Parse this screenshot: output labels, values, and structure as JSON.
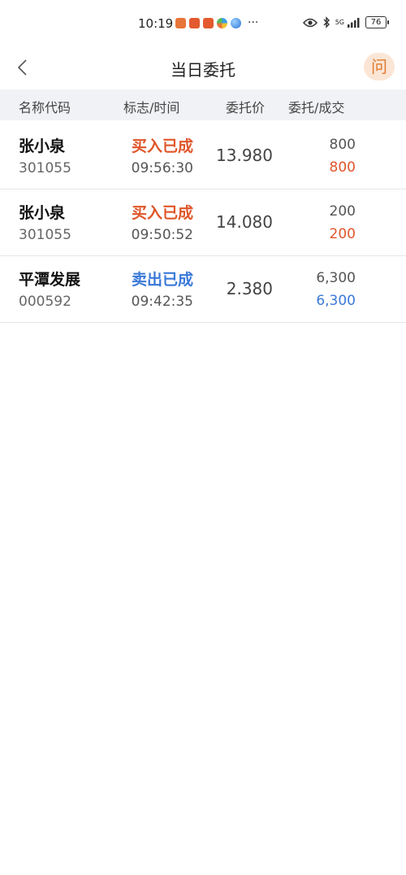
{
  "status_bar": {
    "time": "10:19",
    "network": "5G",
    "battery": "76",
    "more": "···"
  },
  "header": {
    "title": "当日委托",
    "ask_label": "问"
  },
  "columns": {
    "name": "名称代码",
    "flag_time": "标志/时间",
    "price": "委托价",
    "qty_filled": "委托/成交"
  },
  "orders": [
    {
      "name": "张小泉",
      "code": "301055",
      "flag": "买入已成",
      "side": "buy",
      "time": "09:56:30",
      "price": "13.980",
      "qty": "800",
      "filled": "800"
    },
    {
      "name": "张小泉",
      "code": "301055",
      "flag": "买入已成",
      "side": "buy",
      "time": "09:50:52",
      "price": "14.080",
      "qty": "200",
      "filled": "200"
    },
    {
      "name": "平潭发展",
      "code": "000592",
      "flag": "卖出已成",
      "side": "sell",
      "time": "09:42:35",
      "price": "2.380",
      "qty": "6,300",
      "filled": "6,300"
    }
  ],
  "colors": {
    "buy": "#e0562a",
    "sell": "#3b79d8",
    "accent": "#e07a2e"
  }
}
